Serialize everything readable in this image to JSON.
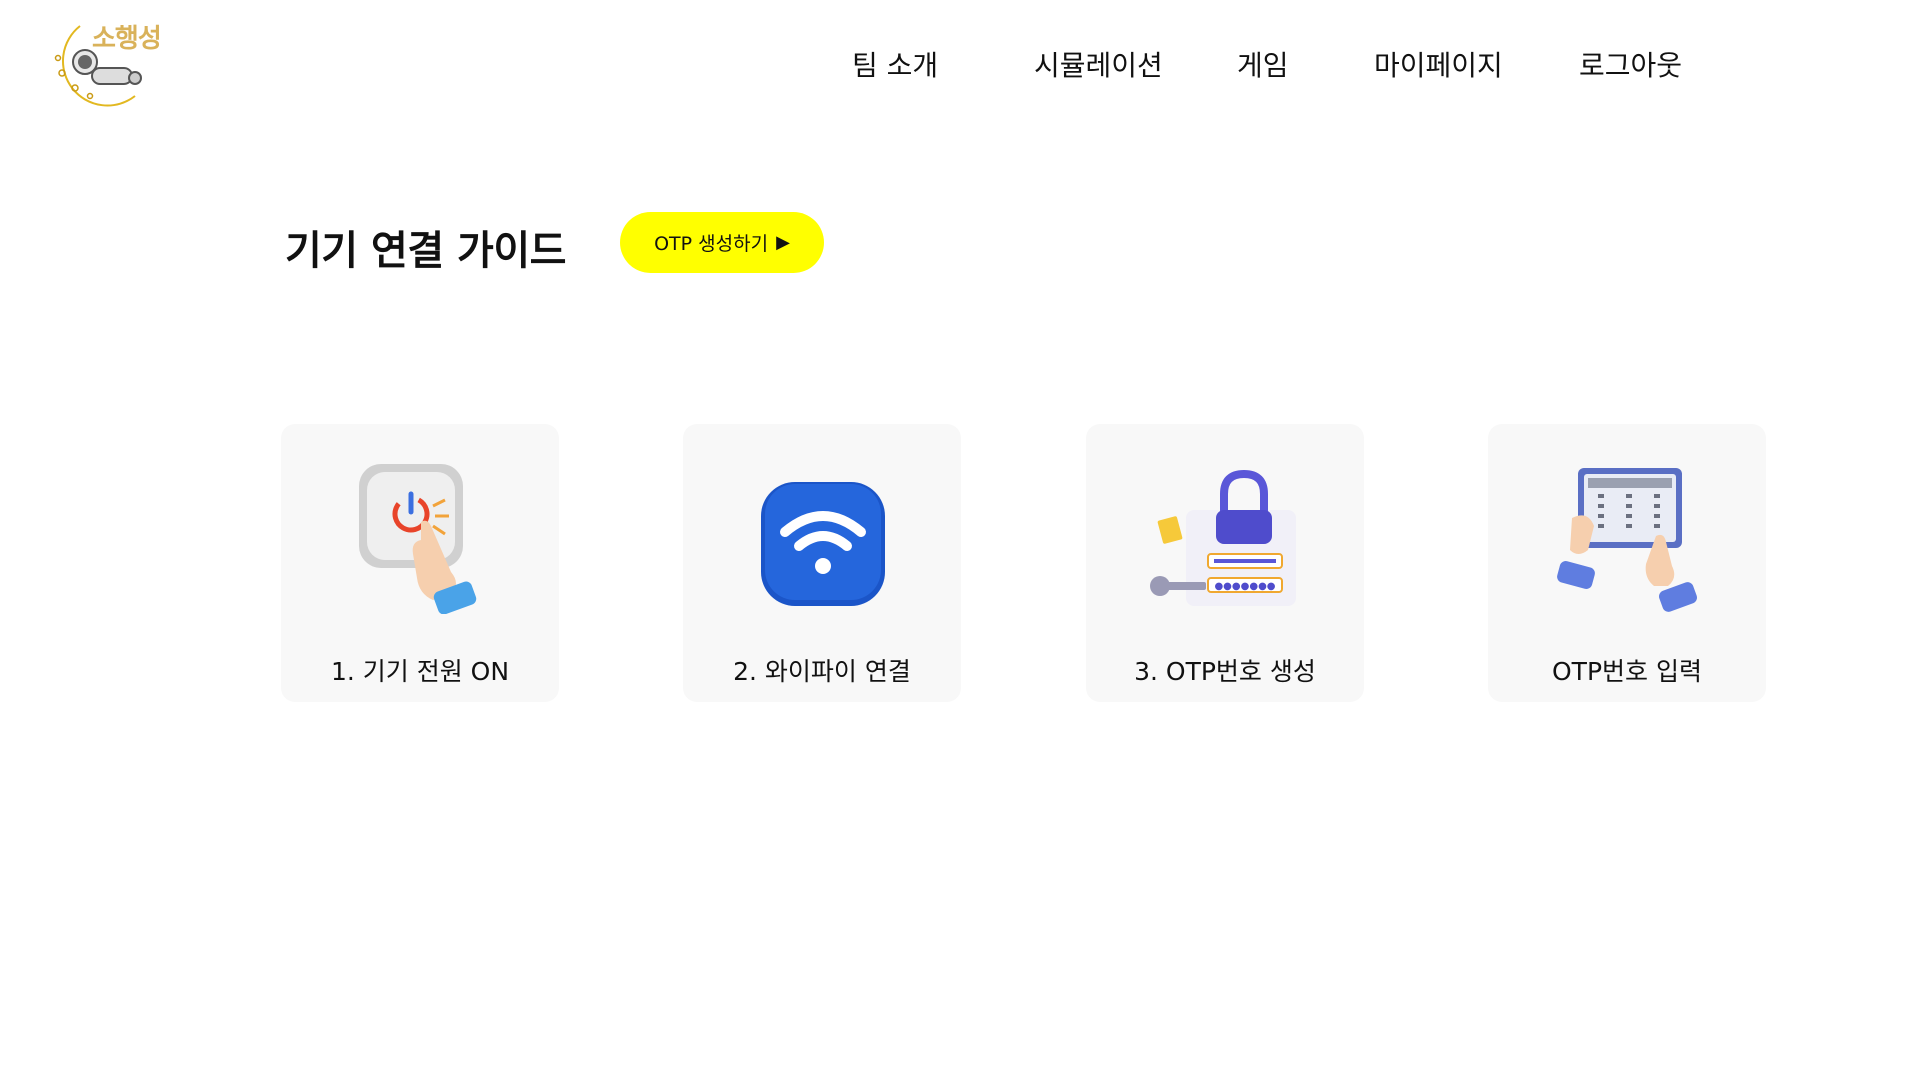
{
  "brand": {
    "name": "소행성",
    "accent": "#d9b25a"
  },
  "nav": {
    "items": [
      {
        "label": "팀 소개"
      },
      {
        "label": "시뮬레이션"
      },
      {
        "label": "게임"
      },
      {
        "label": "마이페이지"
      },
      {
        "label": "로그아웃"
      }
    ]
  },
  "main": {
    "title": "기기 연결 가이드",
    "otp_button": {
      "label": "OTP 생성하기",
      "arrow": "▶",
      "color": "#ffff00"
    },
    "steps": [
      {
        "label": "1. 기기 전원 ON",
        "icon": "power-button-icon"
      },
      {
        "label": "2. 와이파이 연결",
        "icon": "wifi-icon"
      },
      {
        "label": "3. OTP번호 생성",
        "icon": "otp-lock-icon"
      },
      {
        "label": "OTP번호 입력",
        "icon": "keypad-tablet-icon"
      }
    ]
  }
}
